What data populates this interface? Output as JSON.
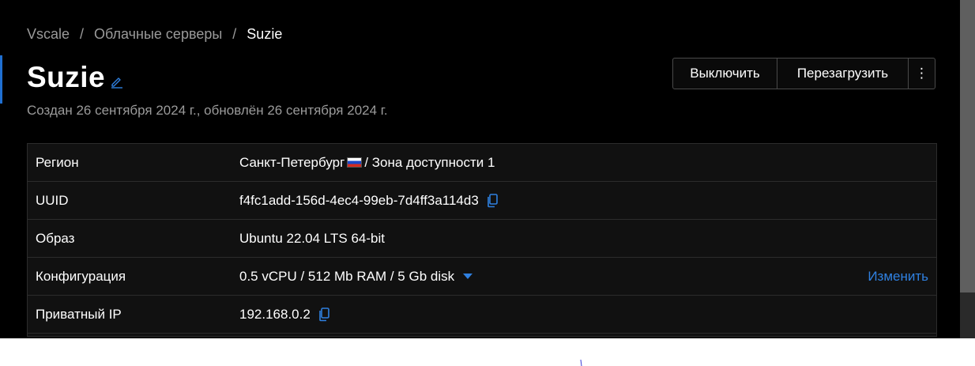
{
  "breadcrumb": {
    "items": [
      "Vscale",
      "Облачные серверы"
    ],
    "current": "Suzie",
    "separator": "/"
  },
  "server": {
    "name": "Suzie",
    "subtitle": "Создан 26 сентября 2024 г., обновлён 26 сентября 2024 г."
  },
  "actions": {
    "power_off": "Выключить",
    "reboot": "Перезагрузить",
    "more": "⋮"
  },
  "details": {
    "region": {
      "label": "Регион",
      "city": "Санкт-Петербург",
      "flag": "russia-flag-icon",
      "zone": "/ Зона доступности 1"
    },
    "uuid": {
      "label": "UUID",
      "value": "f4fc1add-156d-4ec4-99eb-7d4ff3a114d3"
    },
    "image": {
      "label": "Образ",
      "value": "Ubuntu 22.04 LTS 64-bit"
    },
    "config": {
      "label": "Конфигурация",
      "value": "0.5 vCPU / 512 Mb RAM / 5 Gb disk",
      "change_link": "Изменить"
    },
    "private_ip": {
      "label": "Приватный IP",
      "value": "192.168.0.2"
    }
  },
  "icons": {
    "edit": "pencil-icon",
    "copy": "copy-icon",
    "dropdown": "caret-down-icon"
  },
  "colors": {
    "background": "#000000",
    "table_background": "#111111",
    "accent": "#2f80e0",
    "muted_text": "#9a9a9a",
    "border": "#2c2c2c"
  }
}
